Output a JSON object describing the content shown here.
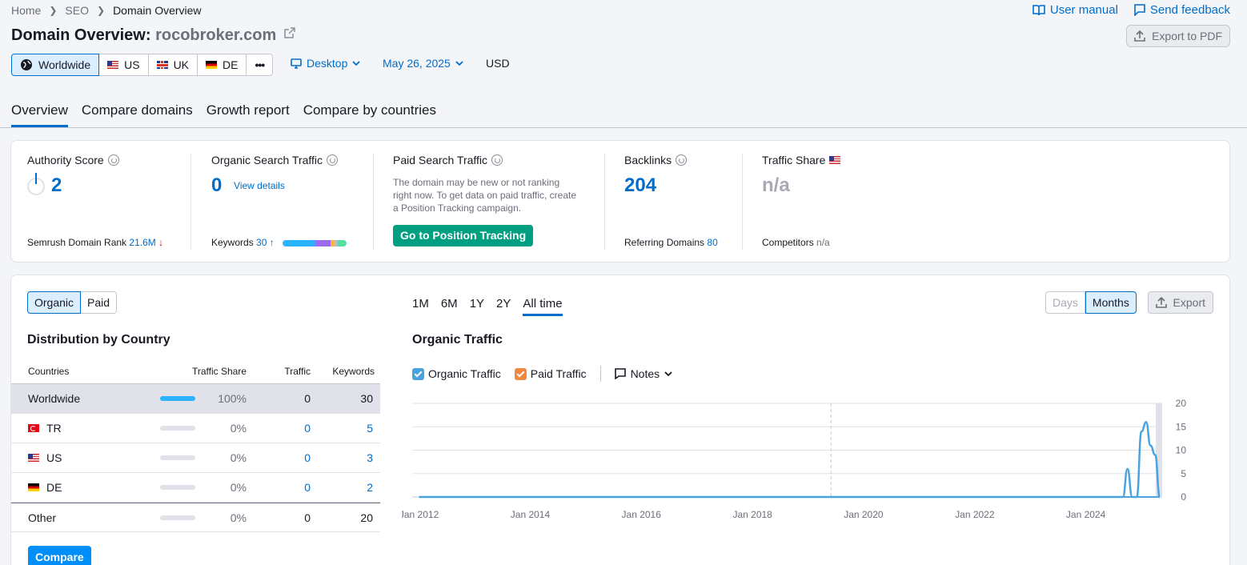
{
  "breadcrumb": {
    "home": "Home",
    "seo": "SEO",
    "current": "Domain Overview"
  },
  "top_links": {
    "manual": "User manual",
    "feedback": "Send feedback"
  },
  "title": {
    "prefix": "Domain Overview:",
    "domain": "rocobroker.com"
  },
  "export_pdf": "Export to PDF",
  "databases": [
    {
      "label": "Worldwide",
      "icon": "globe-icon"
    },
    {
      "label": "US",
      "icon": "flag-us-icon"
    },
    {
      "label": "UK",
      "icon": "flag-uk-icon"
    },
    {
      "label": "DE",
      "icon": "flag-de-icon"
    },
    {
      "label": "•••",
      "icon": "more-icon"
    }
  ],
  "device": "Desktop",
  "date": "May 26, 2025",
  "currency": "USD",
  "tabs": [
    "Overview",
    "Compare domains",
    "Growth report",
    "Compare by countries"
  ],
  "metrics": {
    "authority": {
      "title": "Authority Score",
      "value": "2",
      "sub_label": "Semrush Domain Rank",
      "sub_value": "21.6M",
      "sub_arrow": "↓"
    },
    "organic": {
      "title": "Organic Search Traffic",
      "value": "0",
      "link": "View details",
      "sub_label": "Keywords",
      "sub_value": "30",
      "sub_arrow": "↑"
    },
    "paid": {
      "title": "Paid Search Traffic",
      "desc": "The domain may be new or not ranking right now. To get data on paid traffic, create a Position Tracking campaign.",
      "button": "Go to Position Tracking"
    },
    "backlinks": {
      "title": "Backlinks",
      "value": "204",
      "sub_label": "Referring Domains",
      "sub_value": "80"
    },
    "traffic_share": {
      "title": "Traffic Share",
      "value": "n/a",
      "sub_label": "Competitors",
      "sub_value": "n/a"
    }
  },
  "colors": {
    "accent": "#006dca",
    "green": "#009f81",
    "organic": "#4aa3df",
    "paid": "#f0883e"
  },
  "toggle": [
    "Organic",
    "Paid"
  ],
  "distribution": {
    "title": "Distribution by Country",
    "headers": [
      "Countries",
      "Traffic Share",
      "Traffic",
      "Keywords"
    ],
    "rows": [
      {
        "country": "Worldwide",
        "flag": "",
        "share": "100%",
        "share_value": 100,
        "traffic": "0",
        "keywords": "30"
      },
      {
        "country": "TR",
        "flag": "tr",
        "share": "0%",
        "share_value": 0,
        "traffic": "0",
        "keywords": "5"
      },
      {
        "country": "US",
        "flag": "us",
        "share": "0%",
        "share_value": 0,
        "traffic": "0",
        "keywords": "3"
      },
      {
        "country": "DE",
        "flag": "de",
        "share": "0%",
        "share_value": 0,
        "traffic": "0",
        "keywords": "2"
      },
      {
        "country": "Other",
        "flag": "",
        "share": "0%",
        "share_value": 0,
        "traffic": "0",
        "keywords": "20"
      }
    ],
    "compare_button": "Compare"
  },
  "periods": [
    "1M",
    "6M",
    "1Y",
    "2Y",
    "All time"
  ],
  "granularity": [
    "Days",
    "Months"
  ],
  "export": "Export",
  "chart": {
    "title": "Organic Traffic",
    "legend": {
      "organic": "Organic Traffic",
      "paid": "Paid Traffic",
      "notes": "Notes"
    }
  },
  "chart_data": {
    "type": "line",
    "title": "Organic Traffic",
    "x_ticks": [
      "Jan 2012",
      "Jan 2014",
      "Jan 2016",
      "Jan 2018",
      "Jan 2020",
      "Jan 2022",
      "Jan 2024"
    ],
    "y_ticks": [
      "20",
      "15",
      "10",
      "5",
      "0"
    ],
    "ylim": [
      0,
      20
    ],
    "grid": true,
    "series": [
      {
        "name": "Organic Traffic",
        "points": [
          [
            "2012-01",
            0
          ],
          [
            "2024-06",
            0
          ],
          [
            "2024-09",
            0
          ],
          [
            "2024-10",
            6
          ],
          [
            "2024-11",
            0
          ],
          [
            "2024-12",
            0
          ],
          [
            "2025-01",
            14
          ],
          [
            "2025-02",
            16
          ],
          [
            "2025-03",
            11
          ],
          [
            "2025-04",
            9
          ],
          [
            "2025-05",
            0
          ]
        ]
      },
      {
        "name": "Paid Traffic",
        "points": [
          [
            "2012-01",
            0
          ],
          [
            "2025-05",
            0
          ]
        ]
      }
    ]
  }
}
